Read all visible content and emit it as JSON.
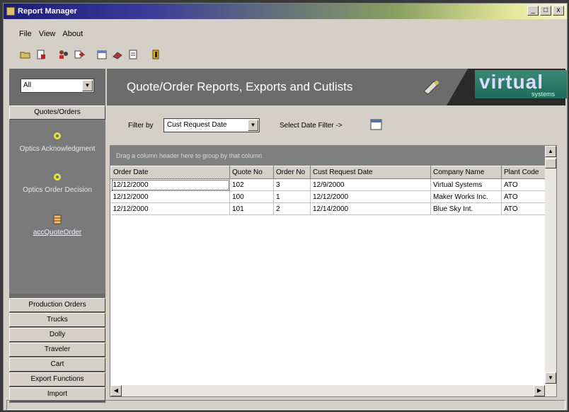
{
  "window": {
    "title": "Report Manager",
    "controls": [
      "_",
      "□",
      "x"
    ]
  },
  "menu": [
    "File",
    "View",
    "About"
  ],
  "sidebar": {
    "filter_value": "All",
    "active_group": "Quotes/Orders",
    "items": [
      "Optics Acknowledgment",
      "Optics Order Decision",
      "accQuoteOrder"
    ],
    "groups": [
      "Production Orders",
      "Trucks",
      "Dolly",
      "Traveler",
      "Cart",
      "Export Functions",
      "Import"
    ]
  },
  "header": {
    "title": "Quote/Order Reports, Exports and Cutlists",
    "logo": "virtual",
    "logo_sub": "systems"
  },
  "filters": {
    "filter_by_label": "Filter by",
    "filter_by_value": "Cust Request Date",
    "date_filter_label": "Select Date Filter ->"
  },
  "grid": {
    "group_hint": "Drag a column header here to group by that column",
    "columns": [
      "Order Date",
      "Quote No",
      "Order No",
      "Cust Request Date",
      "Company Name",
      "Plant Code"
    ],
    "rows": [
      [
        "12/12/2000",
        "102",
        "3",
        "12/9/2000",
        "Virtual Systems",
        "ATO"
      ],
      [
        "12/12/2000",
        "100",
        "1",
        "12/12/2000",
        "Maker Works Inc.",
        "ATO"
      ],
      [
        "12/12/2000",
        "101",
        "2",
        "12/14/2000",
        "Blue Sky Int.",
        "ATO"
      ]
    ]
  }
}
